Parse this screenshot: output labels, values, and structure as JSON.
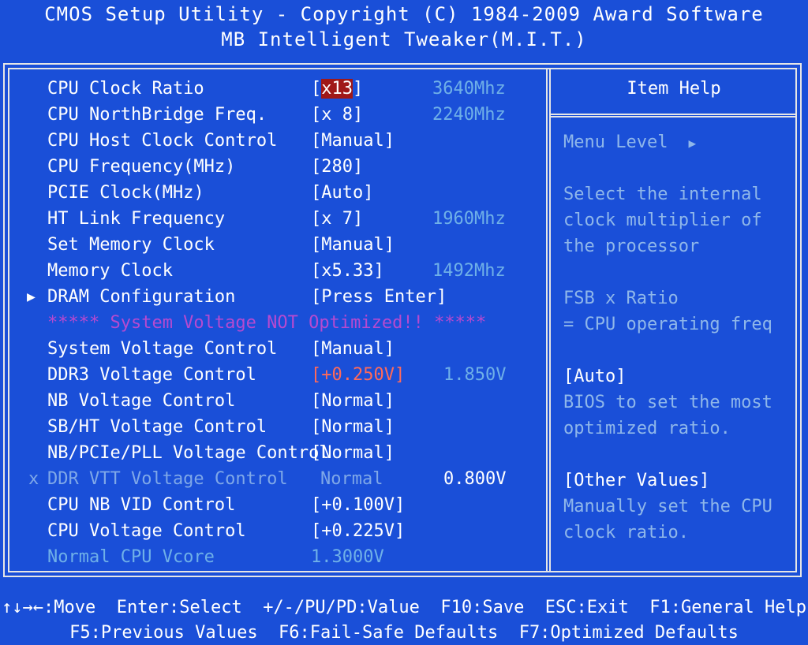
{
  "header": {
    "title": "CMOS Setup Utility - Copyright (C) 1984-2009 Award Software",
    "subtitle": "MB Intelligent Tweaker(M.I.T.)"
  },
  "menu": {
    "rows": [
      {
        "label": "CPU Clock Ratio",
        "value_prefix": "[",
        "value_highlight": "x13",
        "value_suffix": "]",
        "info": "3640Mhz"
      },
      {
        "label": "CPU NorthBridge Freq.",
        "value": "[x 8]",
        "info": "2240Mhz"
      },
      {
        "label": "CPU Host Clock Control",
        "value": "[Manual]"
      },
      {
        "label": "CPU Frequency(MHz)",
        "value": "[280]"
      },
      {
        "label": "PCIE Clock(MHz)",
        "value": "[Auto]"
      },
      {
        "label": "HT Link Frequency",
        "value": "[x 7]",
        "info": "1960Mhz"
      },
      {
        "label": "Set Memory Clock",
        "value": "[Manual]"
      },
      {
        "label": "Memory Clock",
        "value": "[x5.33]",
        "info": "1492Mhz"
      },
      {
        "marker": "▶",
        "label": "DRAM Configuration",
        "value": "[Press Enter]"
      },
      {
        "warning": "***** System Voltage NOT Optimized!! *****"
      },
      {
        "label": "System Voltage Control",
        "value": "[Manual]"
      },
      {
        "label": "DDR3 Voltage Control",
        "value": "[+0.250V]",
        "info": "1.850V"
      },
      {
        "label": "NB Voltage Control",
        "value": "[Normal]"
      },
      {
        "label": "SB/HT Voltage Control",
        "value": "[Normal]"
      },
      {
        "label": "NB/PCIe/PLL Voltage Control",
        "value": "[Normal]"
      },
      {
        "marker": "x",
        "label": "DDR VTT Voltage Control",
        "value": "Normal",
        "info": "0.800V"
      },
      {
        "label": "CPU NB VID Control",
        "value": "[+0.100V]"
      },
      {
        "label": "CPU Voltage Control",
        "value": "[+0.225V]"
      },
      {
        "label": "Normal CPU Vcore",
        "value": "1.3000V"
      }
    ]
  },
  "help": {
    "title": "Item Help",
    "menu_level": "Menu Level",
    "menu_level_arrow": "▶",
    "lines": [
      "Select the internal",
      "clock multiplier of",
      "the processor",
      "FSB x Ratio",
      "= CPU operating freq",
      "[Auto]",
      "BIOS to set the most",
      "optimized ratio.",
      "[Other Values]",
      "Manually set the CPU",
      "clock ratio."
    ]
  },
  "footer": {
    "line1": "↑↓→←:Move  Enter:Select  +/-/PU/PD:Value  F10:Save  ESC:Exit  F1:General Help",
    "line2": "F5:Previous Values  F6:Fail-Safe Defaults  F7:Optimized Defaults"
  },
  "colors": {
    "background": "#1a4fd8",
    "highlight": "#a01818",
    "warning": "#b64ad0",
    "info": "#6fb0e8",
    "changed_value": "#ff6a5a"
  }
}
